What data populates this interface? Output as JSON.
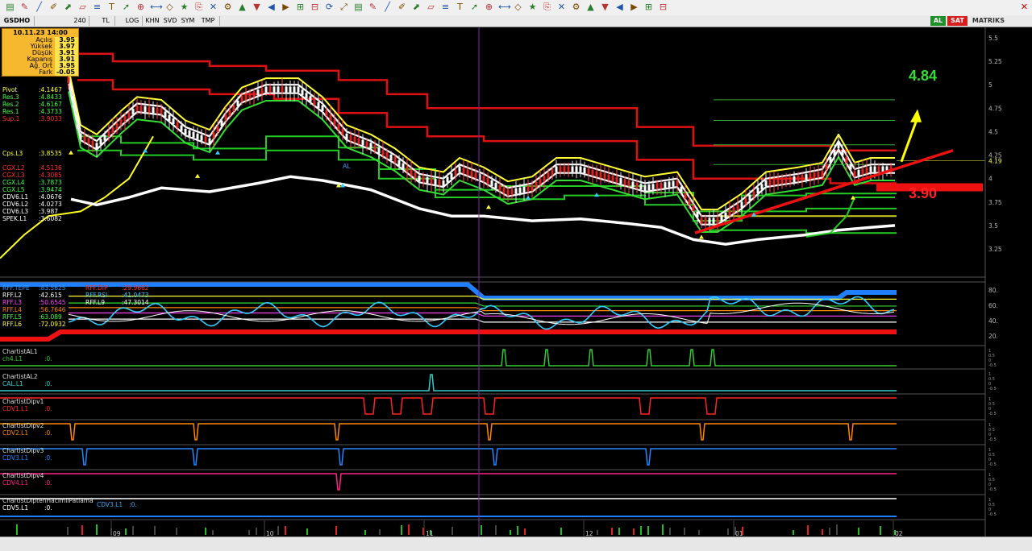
{
  "toolbar": {
    "icons": [
      "chart-icon",
      "pencil-icon",
      "line-icon",
      "brush-icon",
      "trend-icon",
      "channel-icon",
      "fib-icon",
      "text-icon",
      "arrow-icon",
      "zoom-icon",
      "measure-icon",
      "shape-icon",
      "star-icon",
      "copy-icon",
      "delete-icon",
      "settings-icon"
    ]
  },
  "tabs": {
    "symbol": "GSDHO",
    "period": "240",
    "currency": "TL",
    "scale": "LOG",
    "khn": "KHN",
    "svd": "SVD",
    "sym": "SYM",
    "tmp": "TMP",
    "buy": "AL",
    "sell": "SAT",
    "brand": "MATRIKS"
  },
  "ohlc": {
    "datetime": "10.11.23 14:00",
    "rows": [
      {
        "label": "Açılış",
        "value": "3.95"
      },
      {
        "label": "Yüksek",
        "value": "3.97"
      },
      {
        "label": "Düşük",
        "value": "3.91"
      },
      {
        "label": "Kapanış",
        "value": "3.91"
      },
      {
        "label": "Ağ. Ort",
        "value": "3.95"
      },
      {
        "label": "Fark",
        "value": "-0.05"
      }
    ]
  },
  "indicators": [
    {
      "label": "Pivot",
      "value": ":4.1467",
      "color": "#ffff44"
    },
    {
      "label": "Res.3",
      "value": ":4.8433",
      "color": "#44ff44"
    },
    {
      "label": "Res.2",
      "value": ":4.6167",
      "color": "#44ff44"
    },
    {
      "label": "Res.1",
      "value": ":4.3733",
      "color": "#44ff44"
    },
    {
      "label": "Sup.1",
      "value": ":3.9033",
      "color": "#ff3333"
    },
    {
      "label": "Cps.L3",
      "value": ":3.8535",
      "color": "#ffff44"
    },
    {
      "label": "CGX.L2",
      "value": ":4.5136",
      "color": "#ff3333"
    },
    {
      "label": "CGX.L3",
      "value": ":4.3085",
      "color": "#ff3333"
    },
    {
      "label": "CGX.L4",
      "value": ":3.7873",
      "color": "#44ff44"
    },
    {
      "label": "CGX.L5",
      "value": ":3.9474",
      "color": "#44ff44"
    },
    {
      "label": "CDV6.L1",
      "value": ":4.0676",
      "color": "#ffffff"
    },
    {
      "label": "CDV6.L2",
      "value": ":4.0273",
      "color": "#ffffff"
    },
    {
      "label": "CDV6.L3",
      "value": ":3.987",
      "color": "#ffffff"
    },
    {
      "label": "SPEK.L1",
      "value": ":3.6082",
      "color": "#ffffff"
    }
  ],
  "price_axis": [
    "5.5",
    "5.25",
    "5",
    "4.75",
    "4.5",
    "4.25",
    "4",
    "3.75",
    "3.5",
    "3.25"
  ],
  "last_price_tag": "4.19",
  "annotations": {
    "target": "4.84",
    "support": "3.90",
    "al_label": "AL"
  },
  "rff": {
    "rows": [
      {
        "label": "RFF.TEPE",
        "value": ":83.5625",
        "color": "#3399ff"
      },
      {
        "label": "RFF.DIP",
        "value": ":29.9662",
        "color": "#ff3333"
      },
      {
        "label": "RFF.L2",
        "value": ":42.615",
        "color": "#ffffff"
      },
      {
        "label": "RFF.RSI",
        "value": ":41.0473",
        "color": "#33ccff"
      },
      {
        "label": "RFF.L3",
        "value": ":50.6545",
        "color": "#ff44ff"
      },
      {
        "label": "RFF.L9",
        "value": ":47.3014",
        "color": "#ffffff"
      },
      {
        "label": "RFF.L4",
        "value": ":56.7646",
        "color": "#ff8800"
      },
      {
        "label": "RFF.L5",
        "value": ":63.089",
        "color": "#44ff44"
      },
      {
        "label": "RFF.L6",
        "value": ":72.0932",
        "color": "#ffff44"
      }
    ],
    "axis": [
      "80.",
      "60.",
      "40.",
      "20."
    ]
  },
  "panes": [
    {
      "title": "ChartistAL1",
      "series": "ch4.L1",
      "value": ":0.",
      "color": "#33cc33"
    },
    {
      "title": "ChartistAL2",
      "series": "CAL.L1",
      "value": ":0.",
      "color": "#33cccc"
    },
    {
      "title": "ChartistDipv1",
      "series": "CDV1.L1",
      "value": ":0.",
      "color": "#ff2222"
    },
    {
      "title": "ChartistDipv2",
      "series": "CDV2.L1",
      "value": ":0.",
      "color": "#ff8800"
    },
    {
      "title": "ChartistDipv3",
      "series": "CDV3.L1",
      "value": ":0.",
      "color": "#2288ff"
    },
    {
      "title": "ChartistDipv4",
      "series": "CDV4.L1",
      "value": ":0.",
      "color": "#ff2288"
    },
    {
      "title": "ChartistDiptenHacimliPatlama",
      "series": "CDV5.L1",
      "value": ":0.",
      "color": "#ffffff",
      "extra_series": "CDV3.L1",
      "extra_value": ":0."
    }
  ],
  "time_axis": [
    "09",
    "10",
    "11",
    "12",
    "01",
    "02"
  ]
}
